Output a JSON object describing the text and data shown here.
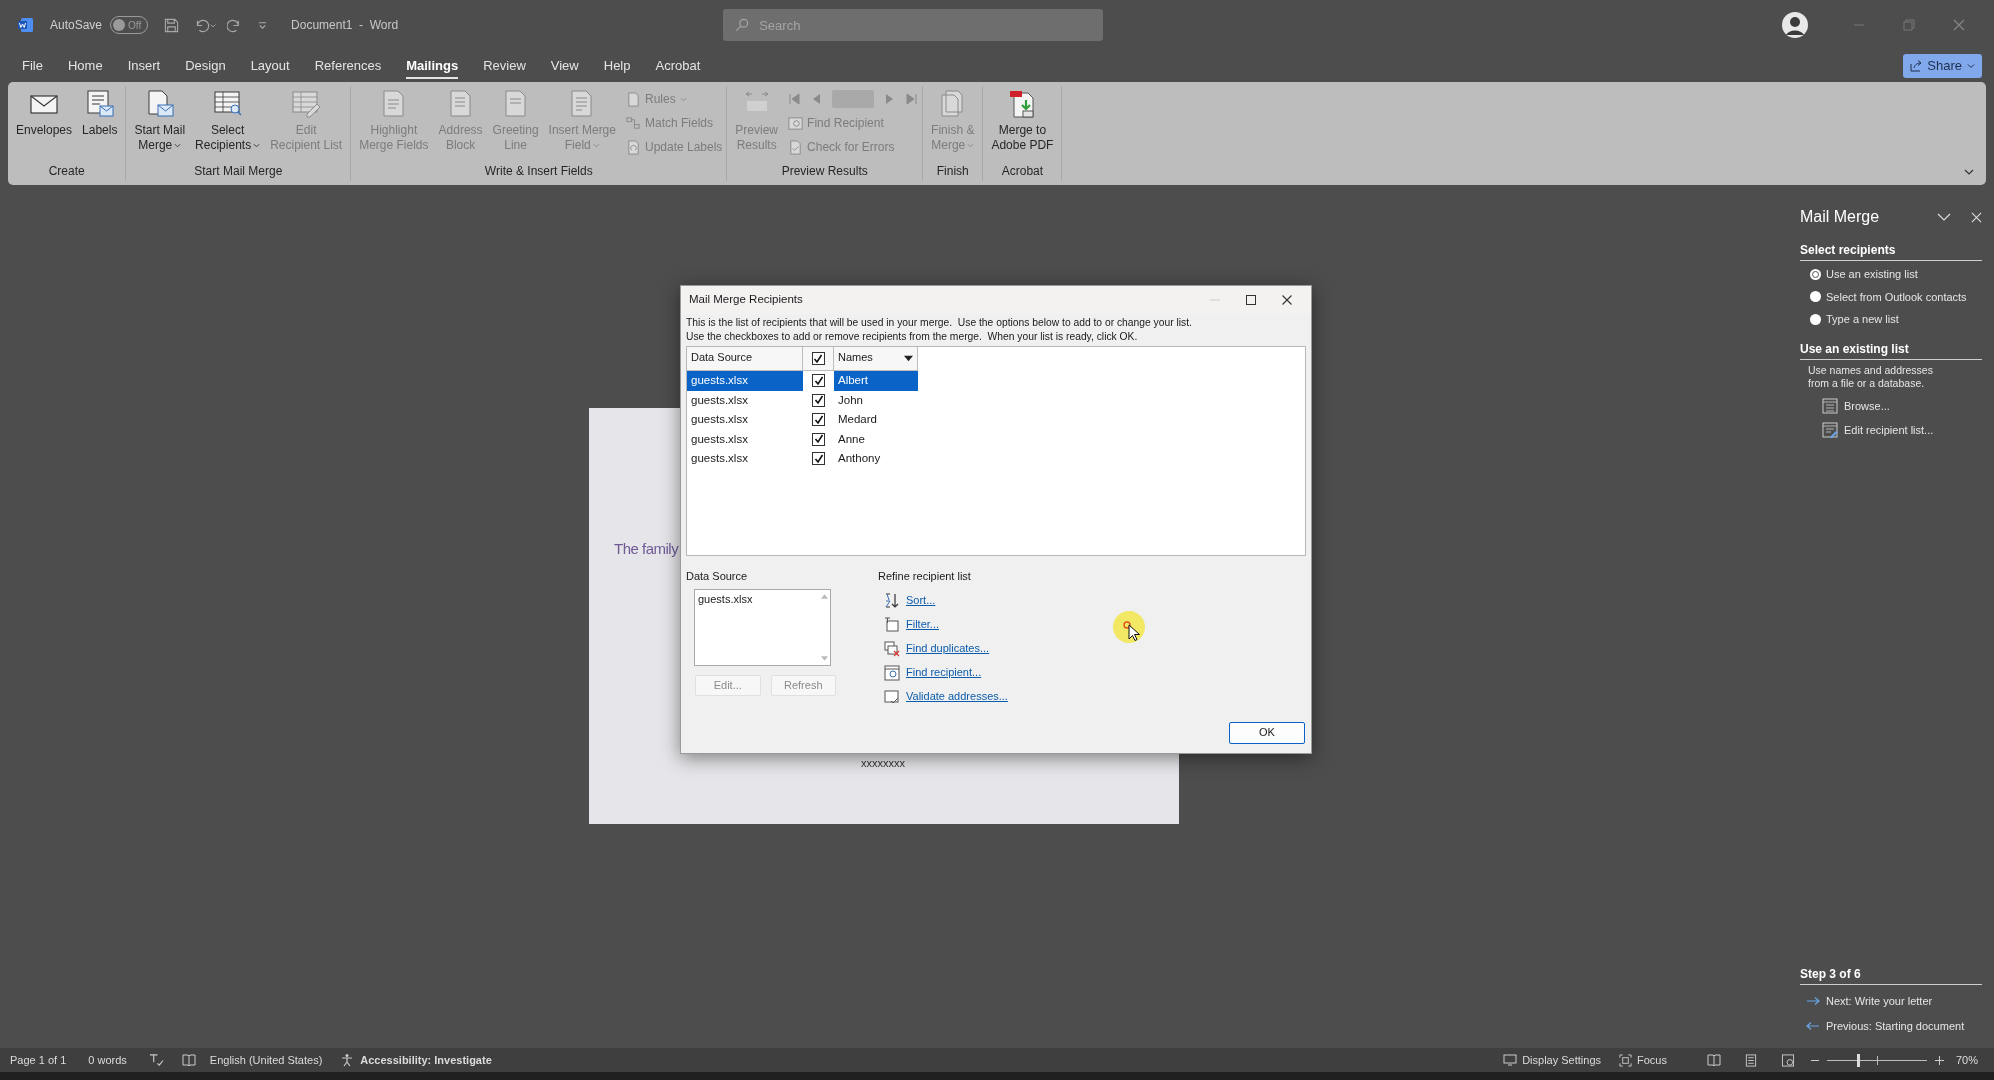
{
  "title_bar": {
    "autosave_label": "AutoSave",
    "autosave_state": "Off",
    "autosave_on": false,
    "document_title": "Document1  -  Word",
    "search": {
      "placeholder": "Search"
    }
  },
  "ribbon_tabs": [
    {
      "label": "File",
      "selected": false
    },
    {
      "label": "Home",
      "selected": false
    },
    {
      "label": "Insert",
      "selected": false
    },
    {
      "label": "Design",
      "selected": false
    },
    {
      "label": "Layout",
      "selected": false
    },
    {
      "label": "References",
      "selected": false
    },
    {
      "label": "Mailings",
      "selected": true
    },
    {
      "label": "Review",
      "selected": false
    },
    {
      "label": "View",
      "selected": false
    },
    {
      "label": "Help",
      "selected": false
    },
    {
      "label": "Acrobat",
      "selected": false
    }
  ],
  "share_button": "Share",
  "ribbon_groups": [
    {
      "label": "Create",
      "items": [
        {
          "kind": "large",
          "lines": [
            "Envelopes"
          ],
          "dropdown": false,
          "disabled": false
        },
        {
          "kind": "large",
          "lines": [
            "Labels"
          ],
          "dropdown": false,
          "disabled": false
        }
      ]
    },
    {
      "label": "Start Mail Merge",
      "items": [
        {
          "kind": "large",
          "lines": [
            "Start Mail",
            "Merge"
          ],
          "dropdown": true,
          "disabled": false
        },
        {
          "kind": "large",
          "lines": [
            "Select",
            "Recipients"
          ],
          "dropdown": true,
          "disabled": false
        },
        {
          "kind": "large",
          "lines": [
            "Edit",
            "Recipient List"
          ],
          "dropdown": false,
          "disabled": true
        }
      ]
    },
    {
      "label": "Write & Insert Fields",
      "items": [
        {
          "kind": "large",
          "lines": [
            "Highlight",
            "Merge Fields"
          ],
          "dropdown": false,
          "disabled": true
        },
        {
          "kind": "large",
          "lines": [
            "Address",
            "Block"
          ],
          "dropdown": false,
          "disabled": true
        },
        {
          "kind": "large",
          "lines": [
            "Greeting",
            "Line"
          ],
          "dropdown": false,
          "disabled": true
        },
        {
          "kind": "large",
          "lines": [
            "Insert Merge",
            "Field"
          ],
          "dropdown": true,
          "disabled": true
        },
        {
          "kind": "stack",
          "items": [
            {
              "kind": "small",
              "label": "Rules",
              "dropdown": true,
              "disabled": true
            },
            {
              "kind": "small",
              "label": "Match Fields",
              "dropdown": false,
              "disabled": true
            },
            {
              "kind": "small",
              "label": "Update Labels",
              "dropdown": false,
              "disabled": true
            }
          ]
        }
      ]
    },
    {
      "label": "Preview Results",
      "items": [
        {
          "kind": "large",
          "lines": [
            "Preview",
            "Results"
          ],
          "dropdown": false,
          "disabled": true
        },
        {
          "kind": "stack",
          "items": [
            {
              "kind": "navigator",
              "disabled": true
            },
            {
              "kind": "small",
              "label": "Find Recipient",
              "dropdown": false,
              "disabled": true
            },
            {
              "kind": "small",
              "label": "Check for Errors",
              "dropdown": false,
              "disabled": true
            }
          ]
        }
      ]
    },
    {
      "label": "Finish",
      "items": [
        {
          "kind": "large",
          "lines": [
            "Finish &",
            "Merge"
          ],
          "dropdown": true,
          "disabled": true
        }
      ]
    },
    {
      "label": "Acrobat",
      "items": [
        {
          "kind": "large",
          "lines": [
            "Merge to",
            "Adobe PDF"
          ],
          "dropdown": false,
          "disabled": false
        }
      ]
    }
  ],
  "document": {
    "text": "The family",
    "merge_placeholder": "xxxxxxxx"
  },
  "dialog": {
    "title": "Mail Merge Recipients",
    "intro": [
      "This is the list of recipients that will be used in your merge.  Use the options below to add to or change your list.",
      "Use the checkboxes to add or remove recipients from the merge.  When your list is ready, click OK."
    ],
    "header": {
      "data_source": "Data Source",
      "all_checked": true,
      "names": "Names"
    },
    "rows": [
      {
        "source": "guests.xlsx",
        "checked": true,
        "name": "Albert",
        "selected": true
      },
      {
        "source": "guests.xlsx",
        "checked": true,
        "name": "John",
        "selected": false
      },
      {
        "source": "guests.xlsx",
        "checked": true,
        "name": "Medard",
        "selected": false
      },
      {
        "source": "guests.xlsx",
        "checked": true,
        "name": "Anne",
        "selected": false
      },
      {
        "source": "guests.xlsx",
        "checked": true,
        "name": "Anthony",
        "selected": false
      }
    ],
    "data_source_label": "Data Source",
    "data_source_items": [
      "guests.xlsx"
    ],
    "data_source_buttons": [
      {
        "label": "Edit...",
        "disabled": true
      },
      {
        "label": "Refresh",
        "disabled": true
      }
    ],
    "refine_label": "Refine recipient list",
    "refine_links": [
      "Sort...",
      "Filter...",
      "Find duplicates...",
      "Find recipient...",
      "Validate addresses..."
    ],
    "ok_button": "OK"
  },
  "task_pane": {
    "title": "Mail Merge",
    "select_heading": "Select recipients",
    "options": [
      {
        "label": "Use an existing list",
        "selected": true
      },
      {
        "label": "Select from Outlook contacts",
        "selected": false
      },
      {
        "label": "Type a new list",
        "selected": false
      }
    ],
    "section_heading": "Use an existing list",
    "description": [
      "Use names and addresses",
      "from a file or a database."
    ],
    "links": [
      "Browse...",
      "Edit recipient list..."
    ],
    "step": "Step 3 of 6",
    "next": "Next: Write your letter",
    "previous": "Previous: Starting document"
  },
  "status_bar": {
    "page": "Page 1 of 1",
    "words": "0 words",
    "language": "English (United States)",
    "accessibility": "Accessibility: Investigate",
    "display_settings": "Display Settings",
    "focus": "Focus",
    "zoom": {
      "level": 0.32
    },
    "zoom_percent": "70%"
  }
}
